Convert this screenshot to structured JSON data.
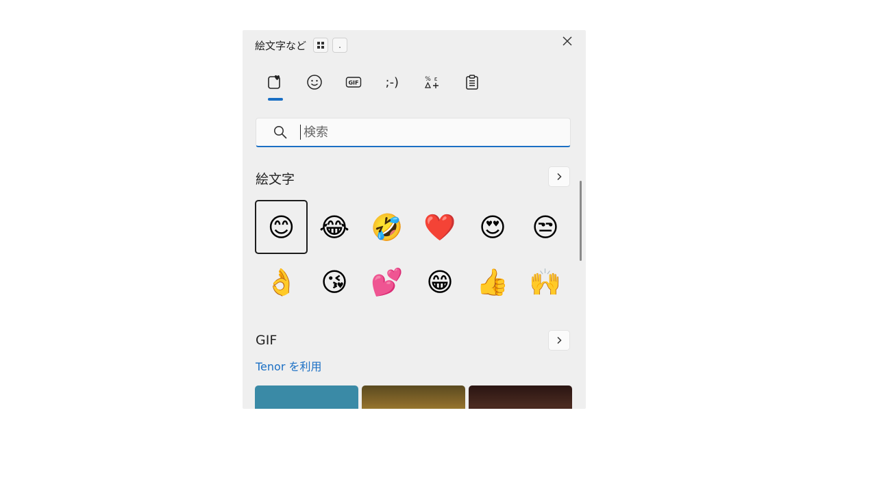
{
  "window": {
    "title": "絵文字など",
    "grid_button_icon": "grid-icon",
    "dot_button_label": ".",
    "close_icon": "close-icon"
  },
  "tabs": [
    {
      "name": "recent",
      "icon": "recent-heart-icon",
      "active": true
    },
    {
      "name": "emoji",
      "icon": "smiley-icon"
    },
    {
      "name": "gif",
      "icon": "gif-icon"
    },
    {
      "name": "kaomoji",
      "label": ";-)"
    },
    {
      "name": "symbols",
      "icon": "symbols-icon"
    },
    {
      "name": "clipboard",
      "icon": "clipboard-icon"
    }
  ],
  "search": {
    "placeholder": "検索",
    "value": ""
  },
  "emoji_section": {
    "title": "絵文字",
    "more_icon": "chevron-right-icon",
    "items": [
      "😊",
      "😂",
      "🤣",
      "❤️",
      "😍",
      "😒",
      "👌",
      "😘",
      "💕",
      "😁",
      "👍",
      "🙌"
    ],
    "selected_index": 0
  },
  "gif_section": {
    "title": "GIF",
    "more_icon": "chevron-right-icon",
    "provider_link": "Tenor を利用",
    "thumbnail_colors": [
      "#3a8aa6",
      "#6a5a2a",
      "#3a1d16"
    ]
  },
  "colors": {
    "accent": "#1a6fc4",
    "panel_bg": "#efefef"
  }
}
